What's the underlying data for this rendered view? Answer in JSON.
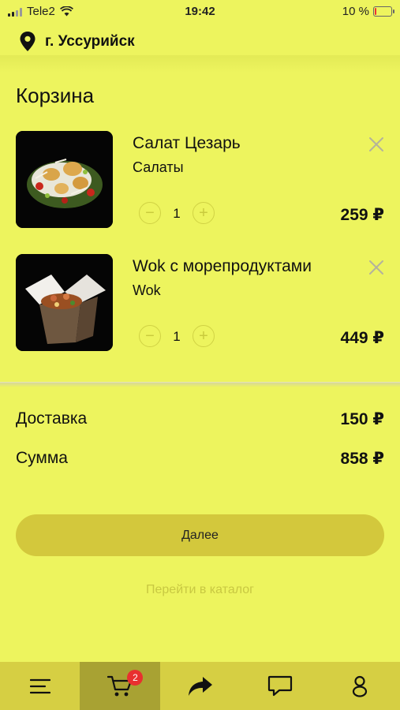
{
  "status_bar": {
    "carrier": "Tele2",
    "time": "19:42",
    "battery": "10 %",
    "battery_level": 0.1
  },
  "location": {
    "city": "г. Уссурийск"
  },
  "page": {
    "title": "Корзина"
  },
  "cart": {
    "items": [
      {
        "name": "Салат Цезарь",
        "category": "Салаты",
        "quantity": "1",
        "price": "259 ₽",
        "image": "caesar-salad-photo"
      },
      {
        "name": "Wok с морепродуктами",
        "category": "Wok",
        "quantity": "1",
        "price": "449 ₽",
        "image": "wok-seafood-box-photo"
      }
    ]
  },
  "summary": {
    "delivery_label": "Доставка",
    "delivery_value": "150 ₽",
    "total_label": "Сумма",
    "total_value": "858 ₽"
  },
  "actions": {
    "next_label": "Далее",
    "catalog_label": "Перейти в каталог"
  },
  "tab_bar": {
    "cart_badge": "2",
    "tabs": [
      "menu-icon",
      "cart-icon",
      "share-arrow-icon",
      "chat-icon",
      "profile-icon"
    ]
  },
  "colors": {
    "background": "#edf45e",
    "tab_bar": "#d6cf43",
    "tab_active": "#a8a233",
    "button": "#d3c83c",
    "badge": "#e8302f"
  }
}
